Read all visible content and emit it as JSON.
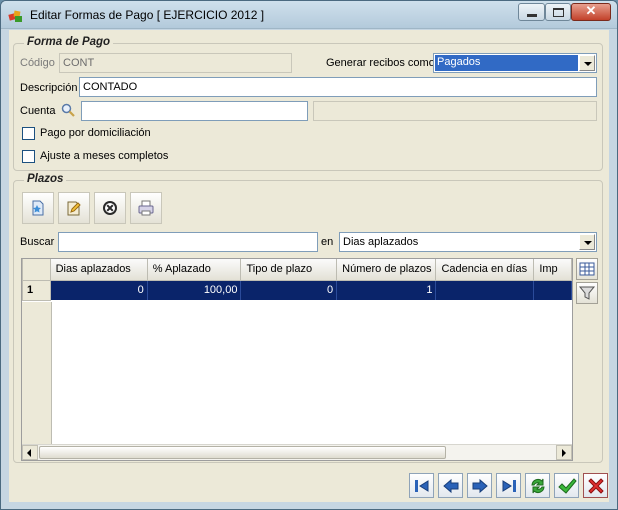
{
  "window": {
    "title": "Editar Formas de Pago [ EJERCICIO 2012 ]"
  },
  "forma_pago": {
    "legend": "Forma de Pago",
    "codigo_label": "Código",
    "codigo_value": "CONT",
    "generar_label": "Generar recibos como",
    "generar_value": "Pagados",
    "descripcion_label": "Descripción",
    "descripcion_value": "CONTADO",
    "cuenta_label": "Cuenta",
    "cuenta_value": "",
    "cuenta_desc": "",
    "pago_domiciliacion_label": "Pago por domiciliación",
    "ajuste_meses_label": "Ajuste a meses completos"
  },
  "plazos": {
    "legend": "Plazos",
    "buscar_label": "Buscar",
    "buscar_value": "",
    "en_label": "en",
    "en_value": "Dias aplazados",
    "columns": [
      "Dias aplazados",
      "% Aplazado",
      "Tipo de plazo",
      "Número de plazos",
      "Cadencia en días",
      "Imp"
    ],
    "rows": [
      {
        "num": "1",
        "dias_aplazados": "0",
        "aplazado": "100,00",
        "tipo_plazo": "0",
        "numero_plazos": "1",
        "cadencia": "",
        "imp": ""
      }
    ]
  },
  "icons": {
    "app": "payment-forms-icon",
    "toolbar": [
      "new-record-icon",
      "edit-record-icon",
      "delete-record-icon",
      "print-icon"
    ],
    "side": [
      "grid-view-icon",
      "filter-icon"
    ],
    "nav": [
      "first-record-icon",
      "previous-record-icon",
      "next-record-icon",
      "last-record-icon",
      "refresh-icon",
      "accept-icon",
      "cancel-icon"
    ]
  },
  "colors": {
    "selection": "#0a246a",
    "accent_select": "#316ac5",
    "title_bar": "#b3cadb"
  }
}
